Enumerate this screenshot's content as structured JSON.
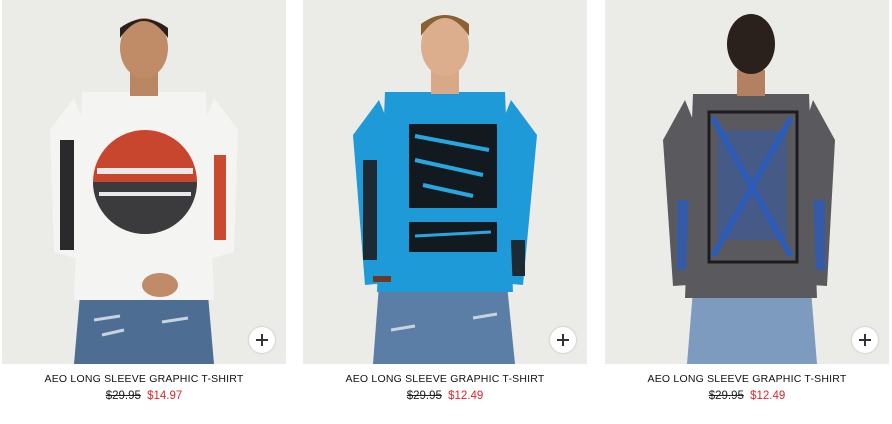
{
  "products": [
    {
      "name": "AEO LONG SLEEVE GRAPHIC T-SHIRT",
      "original_price": "$29.95",
      "sale_price": "$14.97",
      "shirt_color": "#f4f4f2",
      "graphic": "sunset-circle"
    },
    {
      "name": "AEO LONG SLEEVE GRAPHIC T-SHIRT",
      "original_price": "$29.95",
      "sale_price": "$12.49",
      "shirt_color": "#1f9ad8",
      "graphic": "black-blocks"
    },
    {
      "name": "AEO LONG SLEEVE GRAPHIC T-SHIRT",
      "original_price": "$29.95",
      "sale_price": "$12.49",
      "shirt_color": "#5a5a5e",
      "graphic": "blue-grid-back"
    }
  ],
  "icons": {
    "add": "plus-icon"
  },
  "colors": {
    "sale": "#e0242c",
    "background": "#ebebe8"
  }
}
